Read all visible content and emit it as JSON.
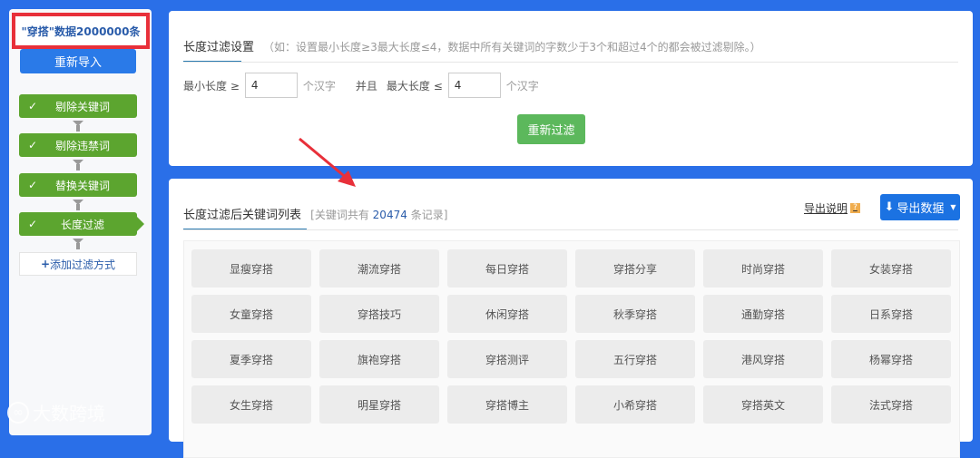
{
  "sidebar": {
    "title": "\"穿搭\"数据2000000条",
    "reimport": "重新导入",
    "steps": [
      {
        "label": "剔除关键词"
      },
      {
        "label": "剔除违禁词"
      },
      {
        "label": "替换关键词"
      },
      {
        "label": "长度过滤"
      }
    ],
    "add": "添加过滤方式",
    "check": "✓",
    "plus": "+"
  },
  "settings": {
    "title": "长度过滤设置",
    "hint": "（如：设置最小长度≥3最大长度≤4，数据中所有关键词的字数少于3个和超过4个的都会被过滤剔除。）",
    "min_label": "最小长度 ≥",
    "min_value": "4",
    "unit": "个汉字",
    "and": "并且",
    "max_label": "最大长度 ≤",
    "max_value": "4",
    "refilter": "重新过滤"
  },
  "list": {
    "title": "长度过滤后关键词列表",
    "count_prefix": "[关键词共有",
    "count": "20474",
    "count_suffix": "条记录]",
    "explain": "导出说明",
    "help": "?",
    "export": "导出数据",
    "keywords": [
      "显瘦穿搭",
      "潮流穿搭",
      "每日穿搭",
      "穿搭分享",
      "时尚穿搭",
      "女装穿搭",
      "女童穿搭",
      "穿搭技巧",
      "休闲穿搭",
      "秋季穿搭",
      "通勤穿搭",
      "日系穿搭",
      "夏季穿搭",
      "旗袍穿搭",
      "穿搭测评",
      "五行穿搭",
      "港风穿搭",
      "杨幂穿搭",
      "女生穿搭",
      "明星穿搭",
      "穿搭博主",
      "小希穿搭",
      "穿搭英文",
      "法式穿搭"
    ]
  },
  "watermark": "大数跨境"
}
